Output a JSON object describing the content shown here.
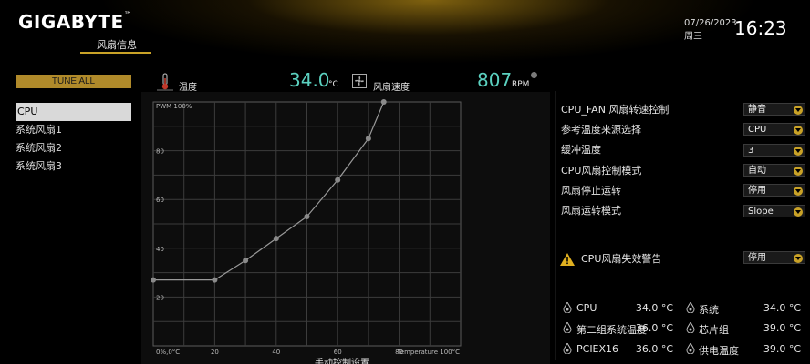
{
  "header": {
    "brand": "GIGABYTE",
    "brand_mark": "™",
    "page_title": "风扇信息",
    "date": "07/26/2023",
    "weekday": "周三",
    "time": "16:23"
  },
  "sidebar": {
    "tune_all_label": "TUNE ALL",
    "items": [
      {
        "label": "CPU",
        "selected": true
      },
      {
        "label": "系统风扇1",
        "selected": false
      },
      {
        "label": "系统风扇2",
        "selected": false
      },
      {
        "label": "系统风扇3",
        "selected": false
      }
    ]
  },
  "readouts": {
    "temperature_label": "温度",
    "temperature_value": "34.0",
    "temperature_unit": "°C",
    "fan_speed_label": "风扇速度",
    "fan_speed_value": "807",
    "fan_speed_unit": "RPM"
  },
  "chart_data": {
    "type": "line",
    "y_axis_title": "PWM 100%",
    "x_axis_title": "Temperature 100°C",
    "origin_label": "0%,0°C",
    "x_ticks": [
      "20",
      "40",
      "60",
      "80"
    ],
    "y_ticks": [
      "20",
      "40",
      "60",
      "80"
    ],
    "xlim": [
      0,
      100
    ],
    "ylim": [
      0,
      100
    ],
    "grid": true,
    "points": [
      {
        "x": 0,
        "y": 27
      },
      {
        "x": 20,
        "y": 27
      },
      {
        "x": 30,
        "y": 35
      },
      {
        "x": 40,
        "y": 44
      },
      {
        "x": 50,
        "y": 53
      },
      {
        "x": 60,
        "y": 68
      },
      {
        "x": 70,
        "y": 85
      },
      {
        "x": 75,
        "y": 100
      }
    ],
    "bottom_caption": "手动控制设置"
  },
  "settings": [
    {
      "label": "CPU_FAN 风扇转速控制",
      "value": "静音"
    },
    {
      "label": "参考温度来源选择",
      "value": "CPU"
    },
    {
      "label": "缓冲温度",
      "value": "3"
    },
    {
      "label": "CPU风扇控制模式",
      "value": "自动"
    },
    {
      "label": "风扇停止运转",
      "value": "停用"
    },
    {
      "label": "风扇运转模式",
      "value": "Slope"
    }
  ],
  "fail_warning": {
    "label": "CPU风扇失效警告",
    "value": "停用"
  },
  "temperatures": [
    {
      "label": "CPU",
      "value": "34.0 °C"
    },
    {
      "label": "系统",
      "value": "34.0 °C"
    },
    {
      "label": "第二组系统温度",
      "value": "36.0 °C"
    },
    {
      "label": "芯片组",
      "value": "39.0 °C"
    },
    {
      "label": "PCIEX16",
      "value": "36.0 °C"
    },
    {
      "label": "供电温度",
      "value": "39.0 °C"
    }
  ],
  "colors": {
    "accent": "#c9a227",
    "readout": "#5bd1c0",
    "background": "#000000"
  }
}
